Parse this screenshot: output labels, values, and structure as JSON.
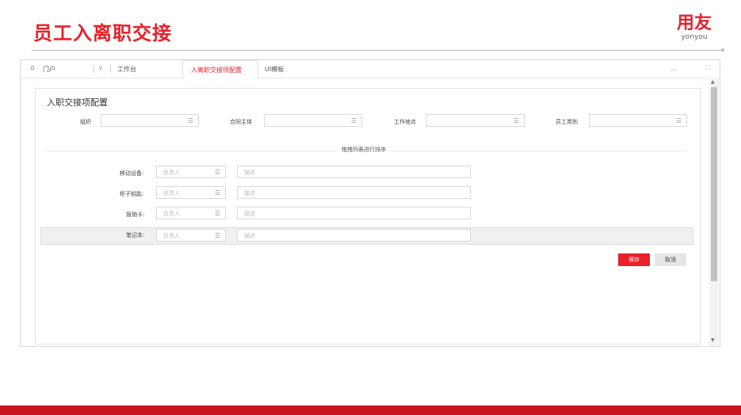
{
  "slide": {
    "title": "员工入离职交接",
    "logo_cn": "用友",
    "logo_en": "yonyou"
  },
  "topbar": {
    "home_label": "门户",
    "dropdown_icon": "chevron-down-icon",
    "workbench_label": "工作台",
    "active_tab_label": "入离职交接项配置",
    "tab2_label": "UI模板"
  },
  "panel": {
    "title": "入职交接项配置",
    "filters": [
      {
        "label": "组织"
      },
      {
        "label": "合同主体"
      },
      {
        "label": "工作地点"
      },
      {
        "label": "员工类别"
      }
    ],
    "divider_text": "拖拽列表进行排序",
    "rows": [
      {
        "label": "移动设备:",
        "owner_placeholder": "负责人",
        "desc_placeholder": "描述"
      },
      {
        "label": "柜子钥匙:",
        "owner_placeholder": "负责人",
        "desc_placeholder": "描述"
      },
      {
        "label": "报销卡:",
        "owner_placeholder": "负责人",
        "desc_placeholder": "描述"
      },
      {
        "label": "笔记本:",
        "owner_placeholder": "负责人",
        "desc_placeholder": "描述"
      }
    ],
    "save_label": "保存",
    "cancel_label": "取消"
  },
  "colors": {
    "accent": "#e8202a",
    "bottom_bar": "#c8151d"
  }
}
